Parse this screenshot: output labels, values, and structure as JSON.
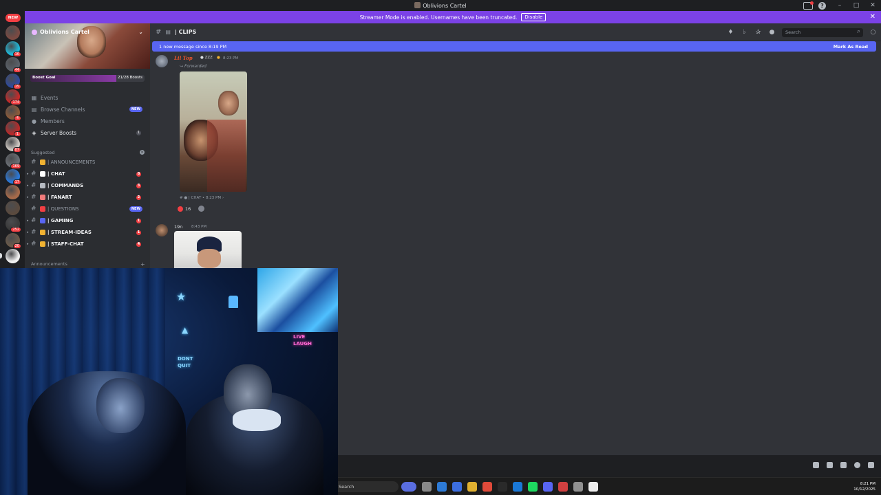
{
  "window": {
    "title": "Oblivions Cartel"
  },
  "banner": {
    "text": "Streamer Mode is enabled. Usernames have been truncated.",
    "disable_label": "Disable"
  },
  "rail": {
    "new_label": "NEW",
    "servers": [
      {
        "badge": "",
        "color": "#7a4a42"
      },
      {
        "badge": "16",
        "color": "#1fb6d6"
      },
      {
        "badge": "44",
        "color": "#5a6068"
      },
      {
        "badge": "15",
        "color": "#2f4a9a"
      },
      {
        "badge": "174",
        "color": "#c42a2a"
      },
      {
        "badge": "4",
        "color": "#8a5a3a"
      },
      {
        "badge": "1",
        "color": "#b82a2a"
      },
      {
        "badge": "87",
        "color": "#ccc6c0"
      },
      {
        "badge": "169",
        "color": "#6a6e74"
      },
      {
        "badge": "17",
        "color": "#2a78d8"
      },
      {
        "badge": "",
        "color": "#a66a4a"
      },
      {
        "badge": "",
        "color": "#5a4a3e"
      },
      {
        "badge": "252",
        "color": "#3a3a3a"
      },
      {
        "badge": "20",
        "color": "#6a5a4a"
      },
      {
        "badge": "",
        "color": "#f0f0f0"
      }
    ]
  },
  "sidebar": {
    "server_name": "Oblivions Cartel",
    "boost_goal_label": "Boost Goal",
    "boost_count": "21/28 Boosts",
    "boost_progress": 0.75,
    "nav": [
      {
        "label": "Events",
        "icon": "calendar-icon"
      },
      {
        "label": "Browse Channels",
        "icon": "browse-icon",
        "pill": "NEW"
      },
      {
        "label": "Members",
        "icon": "members-icon"
      },
      {
        "label": "Server Boosts",
        "icon": "boost-icon",
        "count": "1"
      }
    ],
    "category_suggested": "Suggested",
    "channels": [
      {
        "name": "| ANNOUNCEMENTS",
        "emoji_color": "#f0b232",
        "dim": true
      },
      {
        "name": "| CHAT",
        "emoji_color": "#ffffff",
        "count": "8"
      },
      {
        "name": "| COMMANDS",
        "emoji_color": "#b5bac1",
        "count": "3"
      },
      {
        "name": "| FANART",
        "emoji_color": "#f07a7a",
        "count": "2"
      },
      {
        "name": "| QUESTIONS",
        "emoji_color": "#f23f43",
        "dim": true,
        "pill": "NEW"
      },
      {
        "name": "| GAMING",
        "emoji_color": "#5865f2",
        "count": "1"
      },
      {
        "name": "| STREAM-IDEAS",
        "emoji_color": "#f0b232",
        "count": "1"
      },
      {
        "name": "| STAFF-CHAT",
        "emoji_color": "#f0b232",
        "count": "4"
      }
    ],
    "category_announcements": "Announcements"
  },
  "chat": {
    "channel_name": "| CLIPS",
    "search_placeholder": "Search",
    "new_message_text": "1 new message since 8:19 PM",
    "mark_as_read": "Mark As Read",
    "msg1": {
      "author": "Lil Top",
      "tag": "ZZZ",
      "time": "8:23 PM",
      "forwarded": "Forwarded",
      "source": "| CHAT",
      "source_time": "8:23 PM",
      "reaction_count": "16"
    },
    "msg2": {
      "author": "19n",
      "time": "8:43 PM"
    }
  },
  "taskbar": {
    "search_label": "Search",
    "time": "8:21 PM",
    "date": "10/12/2025",
    "icons": [
      "#5a6ee0",
      "#888888",
      "#2d7ad6",
      "#3c6ee0",
      "#e0b030",
      "#e04a3a",
      "#2a2a2a",
      "#1a78d6",
      "#1ed760",
      "#5865f2",
      "#d04040",
      "#909090",
      "#eeeeee"
    ]
  }
}
